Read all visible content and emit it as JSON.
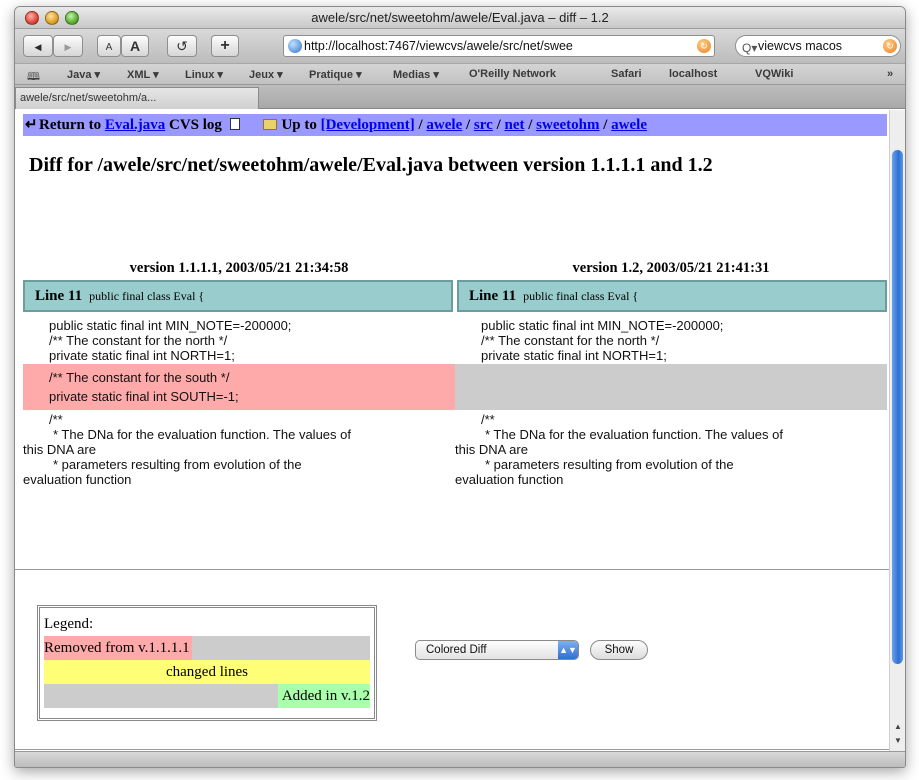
{
  "window": {
    "title": "awele/src/net/sweetohm/awele/Eval.java – diff – 1.2"
  },
  "toolbar": {
    "back_icon": "◀",
    "forward_icon": "▶",
    "text_smaller": "A",
    "text_larger": "A",
    "reload_icon": "↺",
    "add_bookmark": "+",
    "url": "http://localhost:7467/viewcvs/awele/src/net/swee",
    "search_value": "viewcvs macos"
  },
  "bookmarks": {
    "book_icon": "🕮",
    "items": [
      "Java ▾",
      "XML ▾",
      "Linux ▾",
      "Jeux ▾",
      "Pratique ▾",
      "Medias ▾",
      "O'Reilly Network",
      "Safari",
      "localhost",
      "VQWiki"
    ],
    "overflow": "»"
  },
  "tabs": [
    {
      "label": "awele/src/net/sweetohm/a..."
    }
  ],
  "nav": {
    "return_prefix": "Return to ",
    "return_link": "Eval.java",
    "return_suffix": " CVS log",
    "up_prefix": "Up to ",
    "up_link": "[Development]",
    "path": [
      "awele",
      "src",
      "net",
      "sweetohm",
      "awele"
    ]
  },
  "page_title": "Diff for /awele/src/net/sweetohm/awele/Eval.java between version 1.1.1.1 and 1.2",
  "diff": {
    "left_header": "version 1.1.1.1, 2003/05/21 21:34:58",
    "right_header": "version 1.2, 2003/05/21 21:41:31",
    "left_line_label": "Line 11",
    "left_line_context": "public final class Eval {",
    "right_line_label": "Line 11",
    "right_line_context": "public final class Eval {",
    "common_top": [
      "public static final int MIN_NOTE=-200000;",
      "/** The constant for the north */",
      "private static final int NORTH=1;"
    ],
    "removed": [
      "/** The constant for the south */",
      "private static final int SOUTH=-1;"
    ],
    "common_bottom_1": "/**",
    "common_bottom_2": "* The DNa for the evaluation function. The values of",
    "common_bottom_3": "this DNA are",
    "common_bottom_4": "* parameters resulting from evolution of the",
    "common_bottom_5": "evaluation function"
  },
  "legend": {
    "title": "Legend:",
    "removed": "Removed from v.1.1.1.1",
    "changed": "changed lines",
    "added": "Added in v.1.2"
  },
  "controls": {
    "diff_format": "Colored Diff",
    "show_button": "Show"
  },
  "colors": {
    "nav_bg": "#9999ff",
    "line_header_bg": "#99cccc",
    "removed_bg": "#ffaaaa",
    "empty_bg": "#cccccc",
    "changed_bg": "#ffff77",
    "added_bg": "#aaffaa"
  }
}
